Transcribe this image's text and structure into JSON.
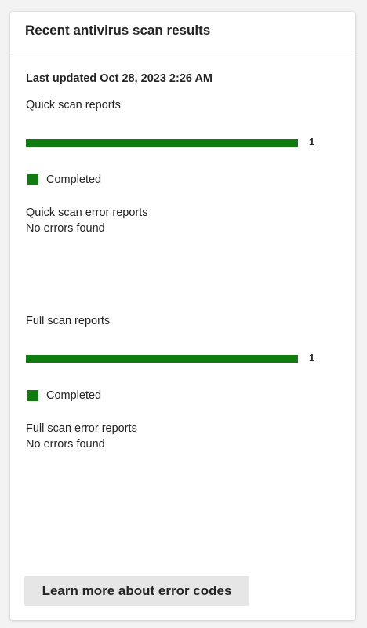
{
  "card": {
    "title": "Recent antivirus scan results",
    "last_updated": "Last updated Oct 28, 2023 2:26 AM"
  },
  "quick_scan": {
    "heading": "Quick scan reports",
    "bar": {
      "value": 1,
      "label": "1",
      "fill_fraction": 1.0,
      "color": "#107c10"
    },
    "legend": {
      "label": "Completed",
      "color": "#107c10"
    },
    "error_heading": "Quick scan error reports",
    "error_text": "No errors found"
  },
  "full_scan": {
    "heading": "Full scan reports",
    "bar": {
      "value": 1,
      "label": "1",
      "fill_fraction": 1.0,
      "color": "#107c10"
    },
    "legend": {
      "label": "Completed",
      "color": "#107c10"
    },
    "error_heading": "Full scan error reports",
    "error_text": "No errors found"
  },
  "footer": {
    "learn_more_label": "Learn more about error codes"
  }
}
